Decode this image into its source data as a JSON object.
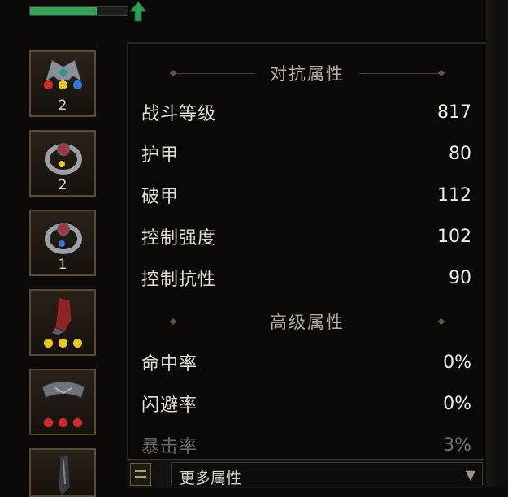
{
  "colors": {
    "accent_green": "#3aa35a",
    "panel_bg": "#0a0908",
    "gem_red": "#d02a2a",
    "gem_yellow": "#e6c82a",
    "gem_blue": "#2f78d8"
  },
  "xp": {
    "progress": 0.68
  },
  "slots": [
    {
      "count": "2",
      "icon": "helmet-icon",
      "gems": [
        "red",
        "yellow",
        "blue"
      ]
    },
    {
      "count": "2",
      "icon": "ring-icon",
      "gems": []
    },
    {
      "count": "1",
      "icon": "ring-icon",
      "gems": []
    },
    {
      "count": "",
      "icon": "gauntlet-icon",
      "gems": [
        "yellow",
        "yellow",
        "yellow"
      ]
    },
    {
      "count": "",
      "icon": "belt-icon",
      "gems": [
        "red",
        "red",
        "red"
      ]
    },
    {
      "count": "",
      "icon": "boots-icon",
      "gems": []
    }
  ],
  "sections": {
    "resist": {
      "title": "对抗属性",
      "stats": [
        {
          "name": "战斗等级",
          "value": "817"
        },
        {
          "name": "护甲",
          "value": "80"
        },
        {
          "name": "破甲",
          "value": "112"
        },
        {
          "name": "控制强度",
          "value": "102"
        },
        {
          "name": "控制抗性",
          "value": "90"
        }
      ]
    },
    "advanced": {
      "title": "高级属性",
      "stats": [
        {
          "name": "命中率",
          "value": "0%"
        },
        {
          "name": "闪避率",
          "value": "0%"
        },
        {
          "name": "暴击率",
          "value": "3%"
        }
      ]
    }
  },
  "more": {
    "label": "更多属性",
    "arrow": "▼"
  }
}
